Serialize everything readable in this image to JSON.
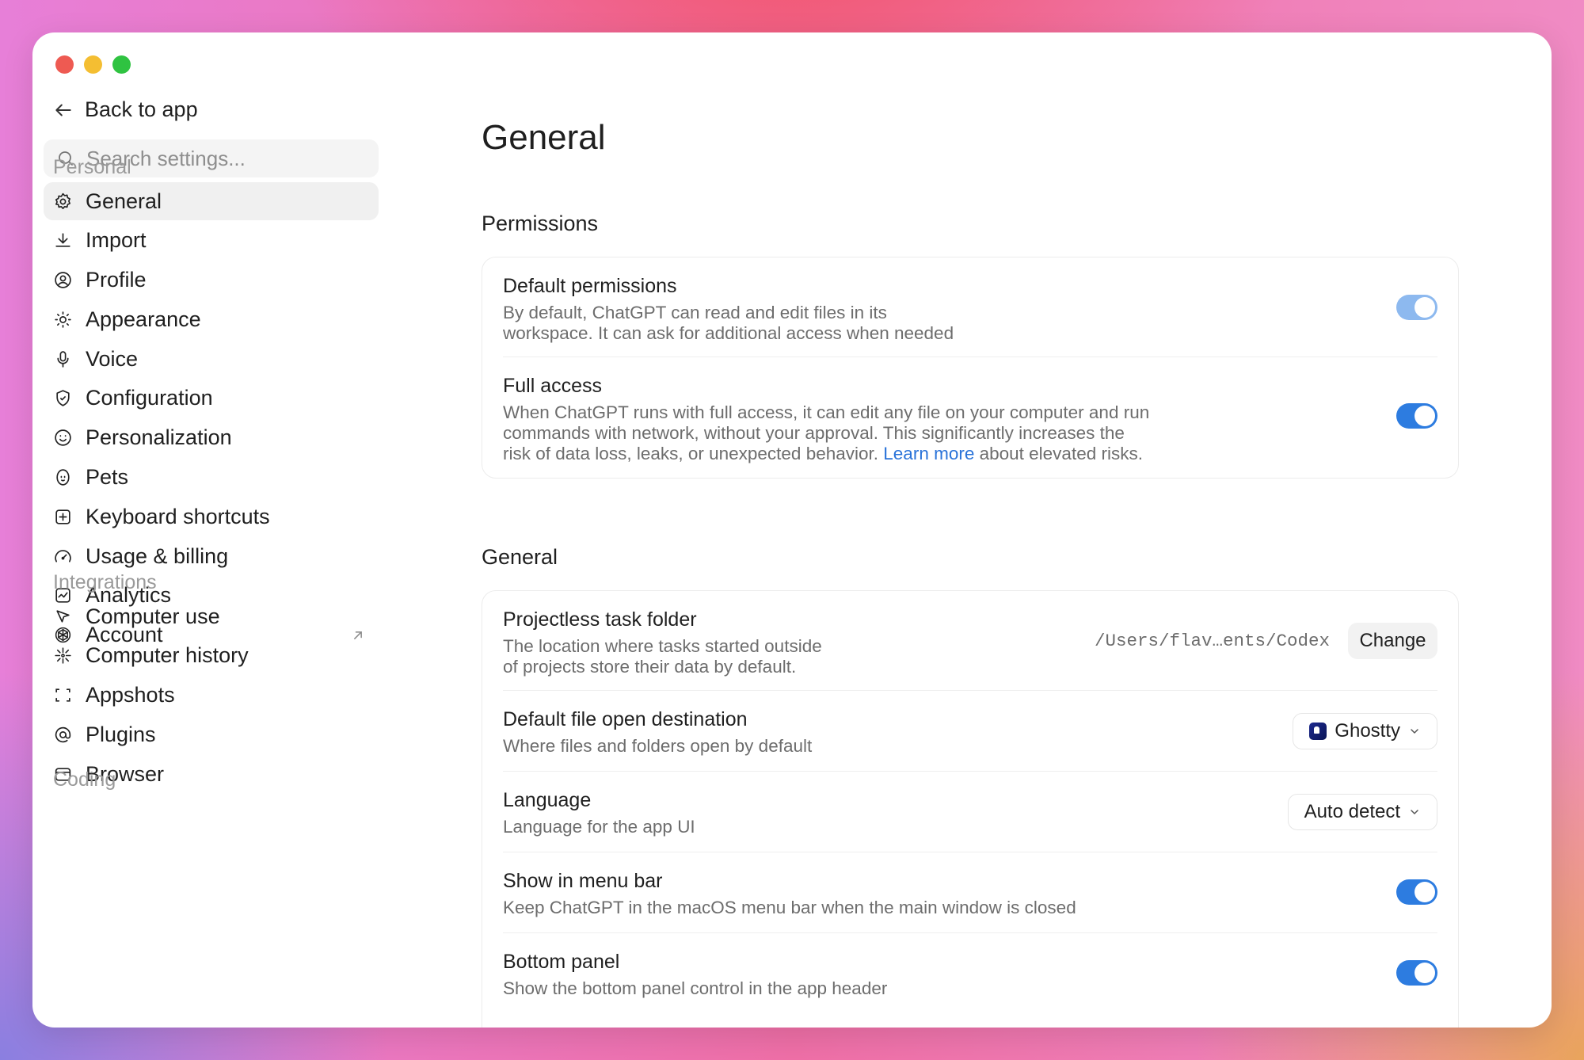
{
  "window": {
    "traffic_lights": [
      "close",
      "minimize",
      "zoom"
    ]
  },
  "sidebar": {
    "back_label": "Back to app",
    "search_placeholder": "Search settings...",
    "sections": [
      {
        "label": "Personal",
        "items": [
          {
            "label": "General",
            "icon": "gear-icon",
            "active": true
          },
          {
            "label": "Import",
            "icon": "download-icon"
          },
          {
            "label": "Profile",
            "icon": "user-circle-icon"
          },
          {
            "label": "Appearance",
            "icon": "sun-icon"
          },
          {
            "label": "Voice",
            "icon": "microphone-icon"
          },
          {
            "label": "Configuration",
            "icon": "shield-icon"
          },
          {
            "label": "Personalization",
            "icon": "smile-icon"
          },
          {
            "label": "Pets",
            "icon": "pet-icon"
          },
          {
            "label": "Keyboard shortcuts",
            "icon": "keyboard-icon"
          },
          {
            "label": "Usage & billing",
            "icon": "gauge-icon"
          },
          {
            "label": "Analytics",
            "icon": "chart-icon"
          },
          {
            "label": "Account",
            "icon": "openai-icon",
            "external": true
          }
        ]
      },
      {
        "label": "Integrations",
        "items": [
          {
            "label": "Computer use",
            "icon": "cursor-icon"
          },
          {
            "label": "Computer history",
            "icon": "sparkle-icon"
          },
          {
            "label": "Appshots",
            "icon": "screenshot-icon"
          },
          {
            "label": "Plugins",
            "icon": "at-icon"
          },
          {
            "label": "Browser",
            "icon": "browser-icon"
          }
        ]
      },
      {
        "label": "Coding",
        "items": []
      }
    ]
  },
  "main": {
    "title": "General",
    "permissions": {
      "title": "Permissions",
      "rows": [
        {
          "title": "Default permissions",
          "desc_line1": "By default, ChatGPT can read and edit files in its",
          "desc_line2": "workspace. It can ask for additional access when needed",
          "toggle_on": true
        },
        {
          "title": "Full access",
          "desc_line1": "When ChatGPT runs with full access, it can edit any file on your computer and run",
          "desc_line2": "commands with network, without your approval. This significantly increases the",
          "desc_line3_pre": "risk of data loss, leaks, or unexpected behavior. ",
          "desc_link": "Learn more",
          "desc_line3_post": " about elevated risks.",
          "toggle_on": true
        }
      ]
    },
    "general": {
      "title": "General",
      "rows": [
        {
          "title": "Projectless task folder",
          "desc_line1": "The location where tasks started outside",
          "desc_line2": "of projects store their data by default.",
          "path": "/Users/flav…ents/Codex",
          "button": "Change"
        },
        {
          "title": "Default file open destination",
          "desc": "Where files and folders open by default",
          "selected": "Ghostty"
        },
        {
          "title": "Language",
          "desc": "Language for the app UI",
          "selected": "Auto detect"
        },
        {
          "title": "Show in menu bar",
          "desc": "Keep ChatGPT in the macOS menu bar when the main window is closed",
          "toggle_on": true
        },
        {
          "title": "Bottom panel",
          "desc": "Show the bottom panel control in the app header",
          "toggle_on": true
        }
      ]
    }
  },
  "colors": {
    "accent": "#2d7ce0",
    "link": "#2a73d9"
  }
}
